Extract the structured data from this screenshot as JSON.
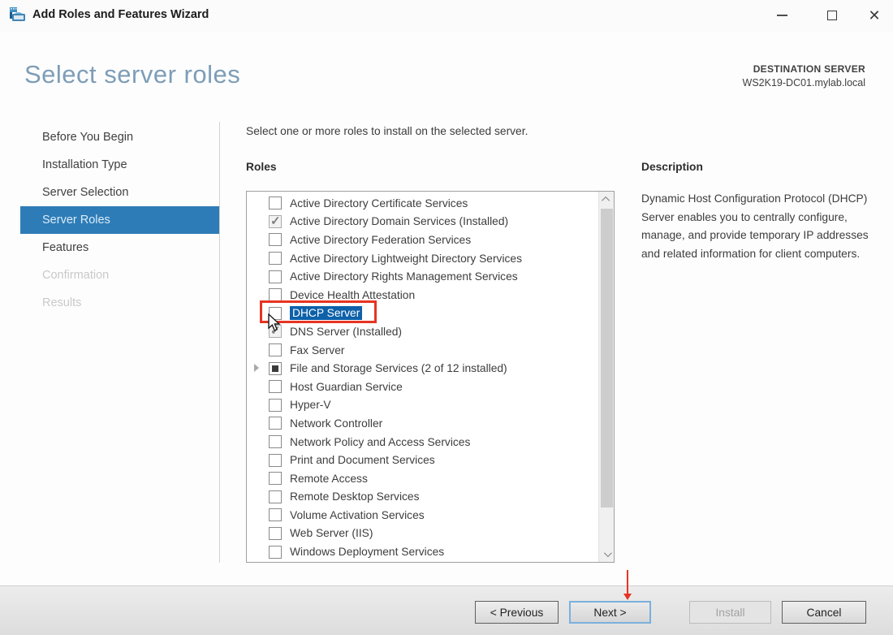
{
  "window": {
    "title": "Add Roles and Features Wizard",
    "icon": "server-manager-icon",
    "controls": {
      "minimize": "–",
      "maximize": "maximize",
      "close": "✕"
    }
  },
  "header": {
    "title": "Select server roles",
    "destination_label": "DESTINATION SERVER",
    "destination_server": "WS2K19-DC01.mylab.local"
  },
  "sidebar": {
    "items": [
      {
        "label": "Before You Begin",
        "state": "enabled"
      },
      {
        "label": "Installation Type",
        "state": "enabled"
      },
      {
        "label": "Server Selection",
        "state": "enabled"
      },
      {
        "label": "Server Roles",
        "state": "selected"
      },
      {
        "label": "Features",
        "state": "enabled"
      },
      {
        "label": "Confirmation",
        "state": "disabled"
      },
      {
        "label": "Results",
        "state": "disabled"
      }
    ]
  },
  "main": {
    "instruction": "Select one or more roles to install on the selected server.",
    "roles_label": "Roles",
    "roles": [
      {
        "label": "Active Directory Certificate Services",
        "checkbox": "unchecked"
      },
      {
        "label": "Active Directory Domain Services (Installed)",
        "checkbox": "checked"
      },
      {
        "label": "Active Directory Federation Services",
        "checkbox": "unchecked"
      },
      {
        "label": "Active Directory Lightweight Directory Services",
        "checkbox": "unchecked"
      },
      {
        "label": "Active Directory Rights Management Services",
        "checkbox": "unchecked"
      },
      {
        "label": "Device Health Attestation",
        "checkbox": "unchecked"
      },
      {
        "label": "DHCP Server",
        "checkbox": "unchecked",
        "selected": true
      },
      {
        "label": "DNS Server (Installed)",
        "checkbox": "checked"
      },
      {
        "label": "Fax Server",
        "checkbox": "unchecked"
      },
      {
        "label": "File and Storage Services (2 of 12 installed)",
        "checkbox": "indeterminate",
        "expandable": true
      },
      {
        "label": "Host Guardian Service",
        "checkbox": "unchecked"
      },
      {
        "label": "Hyper-V",
        "checkbox": "unchecked"
      },
      {
        "label": "Network Controller",
        "checkbox": "unchecked"
      },
      {
        "label": "Network Policy and Access Services",
        "checkbox": "unchecked"
      },
      {
        "label": "Print and Document Services",
        "checkbox": "unchecked"
      },
      {
        "label": "Remote Access",
        "checkbox": "unchecked"
      },
      {
        "label": "Remote Desktop Services",
        "checkbox": "unchecked"
      },
      {
        "label": "Volume Activation Services",
        "checkbox": "unchecked"
      },
      {
        "label": "Web Server (IIS)",
        "checkbox": "unchecked"
      },
      {
        "label": "Windows Deployment Services",
        "checkbox": "unchecked"
      }
    ]
  },
  "description_panel": {
    "heading": "Description",
    "text": "Dynamic Host Configuration Protocol (DHCP) Server enables you to centrally configure, manage, and provide temporary IP addresses and related information for client computers."
  },
  "footer": {
    "buttons": [
      {
        "label": "< Previous",
        "state": "enabled"
      },
      {
        "label": "Next >",
        "state": "focused"
      },
      {
        "label": "Install",
        "state": "disabled"
      },
      {
        "label": "Cancel",
        "state": "enabled"
      }
    ]
  },
  "annotations": {
    "color": "#e63422",
    "box_target": "DHCP Server",
    "arrow_target": "Next >"
  },
  "colors": {
    "sidebar_selected": "#2e7cb7",
    "list_selection": "#0e61a9",
    "heading_blue": "#7d9db7",
    "annotation_red": "#e63422"
  }
}
